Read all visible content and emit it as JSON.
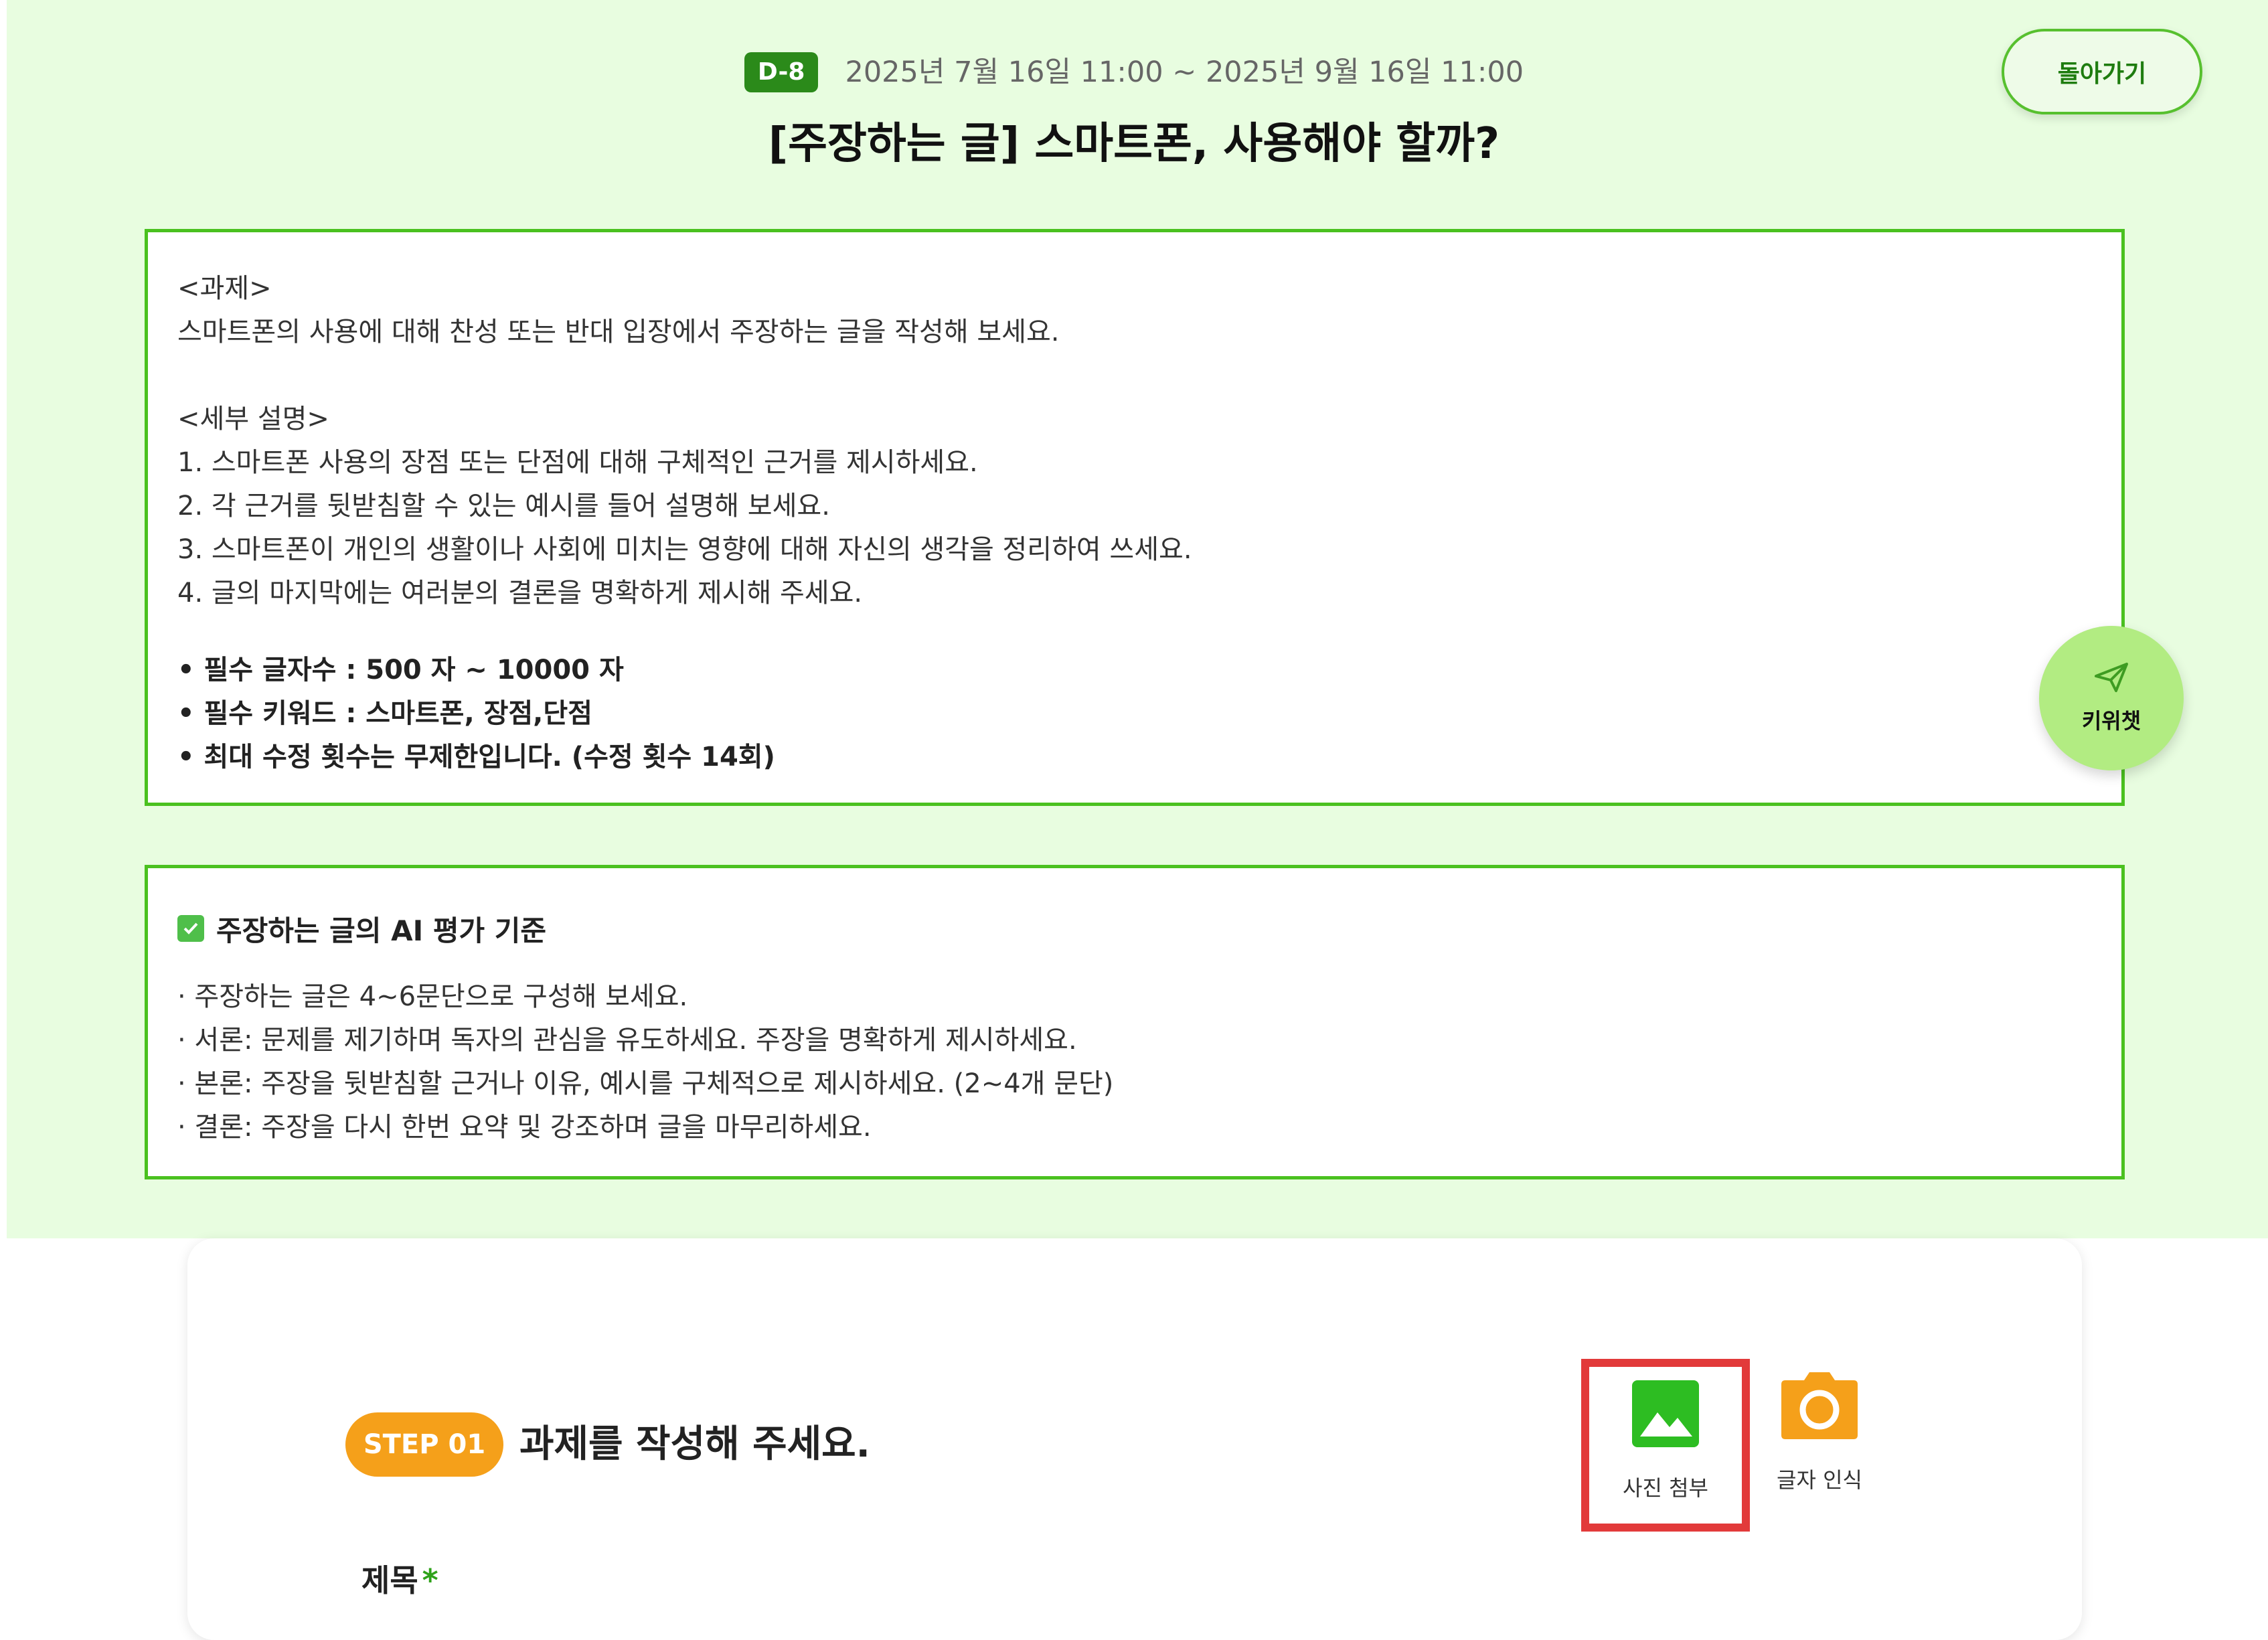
{
  "header": {
    "dday": "D-8",
    "period": "2025년 7월 16일 11:00 ~ 2025년 9월 16일 11:00",
    "title": "[주장하는 글] 스마트폰, 사용해야 할까?",
    "back_label": "돌아가기"
  },
  "task": {
    "heading": "<과제>",
    "prompt": "스마트폰의 사용에 대해 찬성 또는 반대 입장에서 주장하는 글을 작성해 보세요.",
    "detail_heading": "<세부 설명>",
    "details": [
      "1. 스마트폰 사용의 장점 또는 단점에 대해 구체적인 근거를 제시하세요.",
      "2. 각 근거를 뒷받침할 수 있는 예시를 들어 설명해 보세요.",
      "3. 스마트폰이 개인의 생활이나 사회에 미치는 영향에 대해 자신의 생각을 정리하여 쓰세요.",
      "4. 글의 마지막에는 여러분의 결론을 명확하게 제시해 주세요."
    ],
    "requirements": [
      "• 필수 글자수 : 500 자 ~ 10000 자",
      "• 필수 키워드 : 스마트폰, 장점,단점",
      "• 최대 수정 횟수는 무제한입니다. (수정 횟수 14회)"
    ]
  },
  "keychat": {
    "label": "키위챗",
    "icon": "send-icon"
  },
  "criteria": {
    "title": "주장하는 글의 AI 평가 기준",
    "items": [
      "· 주장하는 글은 4~6문단으로 구성해 보세요.",
      "· 서론: 문제를 제기하며 독자의 관심을 유도하세요. 주장을 명확하게 제시하세요.",
      "· 본론: 주장을 뒷받침할 근거나 이유, 예시를 구체적으로 제시하세요. (2~4개 문단)",
      "· 결론: 주장을 다시 한번 요약 및 강조하며 글을 마무리하세요."
    ]
  },
  "step": {
    "badge": "STEP 01",
    "title": "과제를 작성해 주세요.",
    "photo_label": "사진 첨부",
    "ocr_label": "글자 인식",
    "field_label": "제목",
    "required_mark": "*"
  },
  "colors": {
    "page_bg": "#e8fde0",
    "accent_green": "#4ac11f",
    "dday_bg": "#2b8a1a",
    "step_orange": "#f5a01a",
    "highlight_red": "#e23a3a"
  }
}
